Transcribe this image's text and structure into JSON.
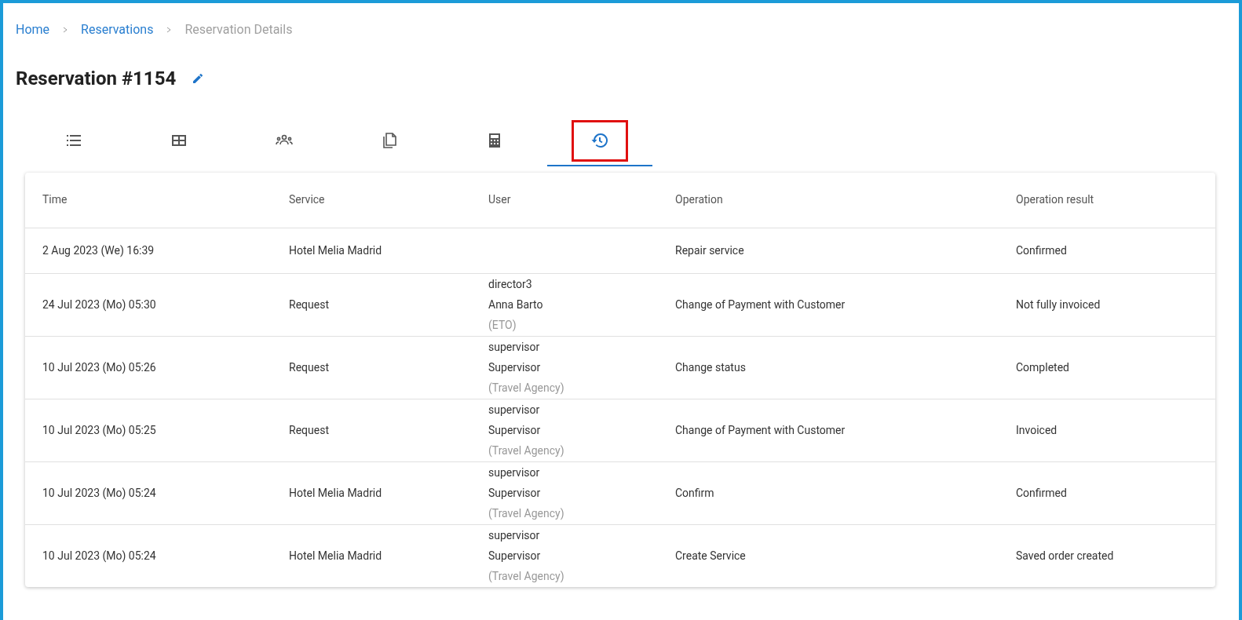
{
  "breadcrumb": [
    {
      "label": "Home",
      "link": true
    },
    {
      "label": "Reservations",
      "link": true
    },
    {
      "label": "Reservation Details",
      "link": false
    }
  ],
  "title": "Reservation #1154",
  "tabs": [
    {
      "selected": false,
      "highlighted": false
    },
    {
      "selected": false,
      "highlighted": false
    },
    {
      "selected": false,
      "highlighted": false
    },
    {
      "selected": false,
      "highlighted": false
    },
    {
      "selected": false,
      "highlighted": false
    },
    {
      "selected": true,
      "highlighted": true
    }
  ],
  "table": {
    "columns": [
      "Time",
      "Service",
      "User",
      "Operation",
      "Operation result"
    ],
    "rows": [
      {
        "time": "2 Aug 2023 (We) 16:39",
        "service": "Hotel Melia Madrid",
        "operation": "Repair service",
        "result": "Confirmed"
      },
      {
        "time": "24 Jul 2023 (Mo) 05:30",
        "service": "Request",
        "user": {
          "login": "director3",
          "name": "Anna Barto",
          "org": "(ETO)"
        },
        "operation": "Change of Payment with Customer",
        "result": "Not fully invoiced"
      },
      {
        "time": "10 Jul 2023 (Mo) 05:26",
        "service": "Request",
        "user": {
          "login": "supervisor",
          "name": "Supervisor",
          "org": "(Travel Agency)"
        },
        "operation": "Change status",
        "result": "Completed"
      },
      {
        "time": "10 Jul 2023 (Mo) 05:25",
        "service": "Request",
        "user": {
          "login": "supervisor",
          "name": "Supervisor",
          "org": "(Travel Agency)"
        },
        "operation": "Change of Payment with Customer",
        "result": "Invoiced"
      },
      {
        "time": "10 Jul 2023 (Mo) 05:24",
        "service": "Hotel Melia Madrid",
        "user": {
          "login": "supervisor",
          "name": "Supervisor",
          "org": "(Travel Agency)"
        },
        "operation": "Confirm",
        "result": "Confirmed"
      },
      {
        "time": "10 Jul 2023 (Mo) 05:24",
        "service": "Hotel Melia Madrid",
        "user": {
          "login": "supervisor",
          "name": "Supervisor",
          "org": "(Travel Agency)"
        },
        "operation": "Create Service",
        "result": "Saved order created"
      }
    ]
  }
}
